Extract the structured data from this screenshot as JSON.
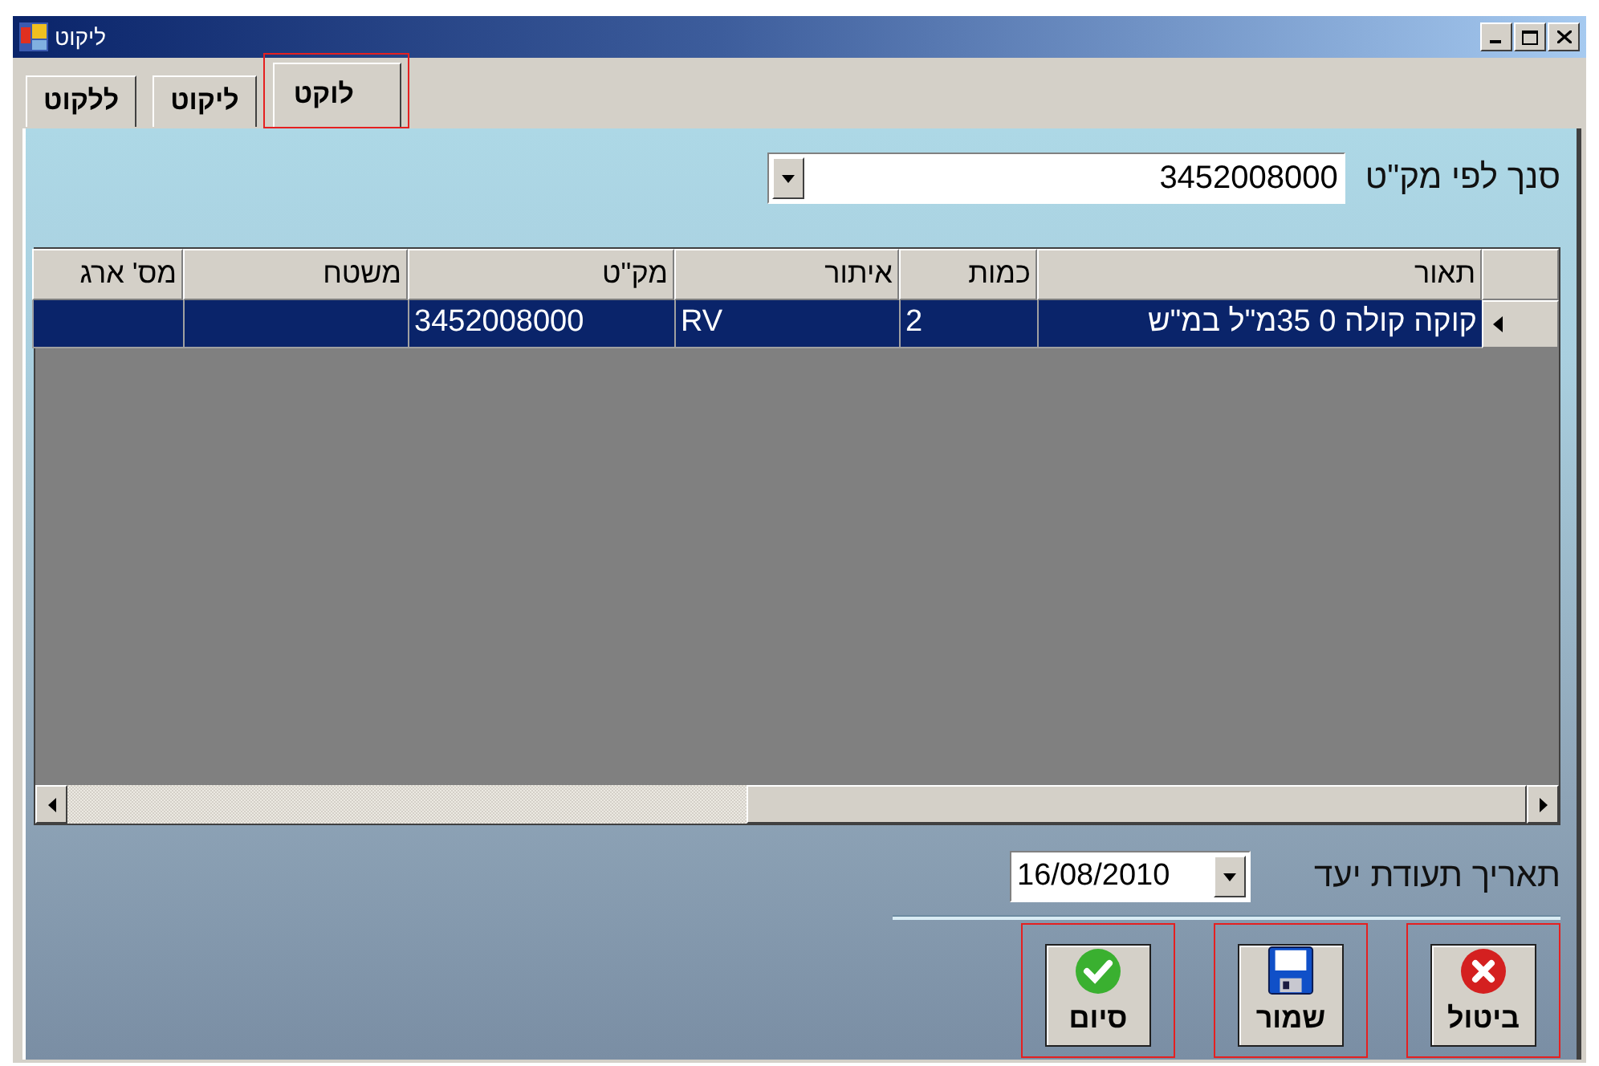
{
  "window": {
    "title": "ליקוט"
  },
  "tabs": [
    {
      "label": "לוקט",
      "selected": true,
      "highlighted": true
    },
    {
      "label": "ליקוט",
      "selected": false,
      "highlighted": false
    },
    {
      "label": "ללקוט",
      "selected": false,
      "highlighted": false
    }
  ],
  "scan": {
    "label": "סנך לפי מק\"ט",
    "value": "3452008000"
  },
  "table": {
    "columns": [
      "תאור",
      "כמות",
      "איתור",
      "מק\"ט",
      "משטח",
      "מס' ארג"
    ],
    "rows": [
      {
        "cells": [
          "קוקה קולה 0 35מ\"ל במ\"ש",
          "2",
          "RV",
          "3452008000"
        ],
        "selected": true
      }
    ]
  },
  "due_date": {
    "label": "תאריך תעודת יעד",
    "value": "16/08/2010"
  },
  "buttons": [
    {
      "kind": "cancel",
      "label": "ביטול",
      "highlighted": true
    },
    {
      "kind": "save",
      "label": "שמור",
      "highlighted": true
    },
    {
      "kind": "finish",
      "label": "סיום",
      "highlighted": true
    }
  ]
}
